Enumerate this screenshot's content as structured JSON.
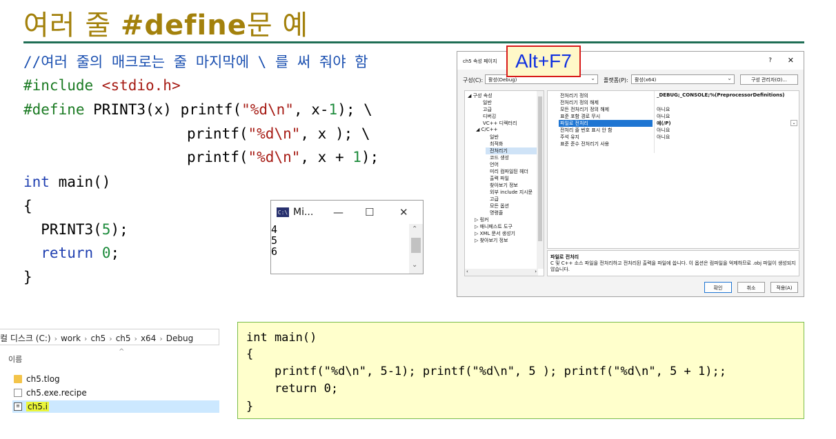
{
  "slide": {
    "title_prefix": "여러 줄 ",
    "title_bold": "#define",
    "title_suffix": "문 예"
  },
  "code": {
    "comment": "//여러 줄의 매크로는 줄 마지막에 \\ 를 써 줘야 함",
    "include_kw": "#include ",
    "include_target": "<stdio.h>",
    "define_kw": "#define",
    "define_head": " PRINT3(x) printf(",
    "fmt": "\"%d\\n\"",
    "l1_mid": ", x-",
    "num1": "1",
    "l1_end": "); \\",
    "l2_pre": "printf(",
    "l2_end": ", x ); \\",
    "l3_pre": "printf(",
    "l3_mid": ", x + ",
    "l3_end": ");",
    "int_kw": "int",
    "main_sig": " main()",
    "open_brace": "{",
    "call_pre": "  PRINT3(",
    "num5": "5",
    "call_end": ");",
    "return_kw": "  return",
    "num0": "0",
    "semi": ";",
    "close_brace": "}"
  },
  "console": {
    "title": "Mi...",
    "minimize": "—",
    "maximize": "☐",
    "close": "✕",
    "output": [
      "4",
      "5",
      "6"
    ]
  },
  "dialog": {
    "title": "ch5 속성 페이지",
    "help": "?",
    "close": "✕",
    "shortcut": "Alt+F7",
    "config_label": "구성(C):",
    "config_value": "활성(Debug)",
    "platform_label": "플랫폼(P):",
    "platform_value": "활성(x64)",
    "config_manager": "구성 관리자(O)...",
    "tree": [
      {
        "label": "◢ 구성 속성",
        "selected": false
      },
      {
        "label": "일반",
        "selected": false
      },
      {
        "label": "고급",
        "selected": false
      },
      {
        "label": "디버깅",
        "selected": false
      },
      {
        "label": "VC++ 디렉터리",
        "selected": false
      },
      {
        "label": "◢ C/C++",
        "selected": false
      },
      {
        "label": "일반",
        "selected": false
      },
      {
        "label": "최적화",
        "selected": false
      },
      {
        "label": "전처리기",
        "selected": true
      },
      {
        "label": "코드 생성",
        "selected": false
      },
      {
        "label": "언어",
        "selected": false
      },
      {
        "label": "미리 컴파일된 헤더",
        "selected": false
      },
      {
        "label": "출력 파일",
        "selected": false
      },
      {
        "label": "찾아보기 정보",
        "selected": false
      },
      {
        "label": "외부 include 지시문",
        "selected": false
      },
      {
        "label": "고급",
        "selected": false
      },
      {
        "label": "모든 옵션",
        "selected": false
      },
      {
        "label": "명령줄",
        "selected": false
      },
      {
        "label": "▷ 링커",
        "selected": false
      },
      {
        "label": "▷ 매니페스트 도구",
        "selected": false
      },
      {
        "label": "▷ XML 문서 생성기",
        "selected": false
      },
      {
        "label": "▷ 찾아보기 정보",
        "selected": false
      }
    ],
    "props": [
      {
        "key": "전처리기 정의",
        "value": "_DEBUG;_CONSOLE;%(PreprocessorDefinitions)",
        "bold": true
      },
      {
        "key": "전처리기 정의 해제",
        "value": ""
      },
      {
        "key": "모든 전처리기 정의 해제",
        "value": "아니요"
      },
      {
        "key": "표준 포함 경로 무시",
        "value": "아니요"
      },
      {
        "key": "파일로 전처리",
        "value": "예(/P)",
        "bold": true
      },
      {
        "key": "전처리 줄 번호 표시 안 함",
        "value": "아니요"
      },
      {
        "key": "주석 유지",
        "value": "아니요"
      },
      {
        "key": "표준 준수 전처리기 사용",
        "value": ""
      }
    ],
    "desc_title": "파일로 전처리",
    "desc_text": "C 및 C++ 소스 파일을 전처리하고 전처리된 출력을 파일에 씁니다. 이 옵션은 컴파일을 억제하므로 .obj 파일이 생성되지 않습니다.",
    "ok": "확인",
    "cancel": "취소",
    "apply": "적용(A)"
  },
  "explorer": {
    "crumbs": [
      "컬 디스크 (C:)",
      "work",
      "ch5",
      "ch5",
      "x64",
      "Debug"
    ],
    "sep": "›",
    "column": "이름",
    "sort_caret": "^",
    "files": [
      {
        "name": "ch5.tlog",
        "type": "folder"
      },
      {
        "name": "ch5.exe.recipe",
        "type": "file"
      },
      {
        "name": "ch5.i",
        "type": "i-file",
        "selected": true
      }
    ]
  },
  "result": {
    "lines": [
      "int main()",
      "{",
      "    printf(\"%d\\n\", 5-1); printf(\"%d\\n\", 5 ); printf(\"%d\\n\", 5 + 1);;",
      "    return 0;",
      "}"
    ]
  }
}
